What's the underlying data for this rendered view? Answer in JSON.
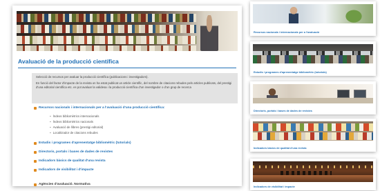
{
  "main": {
    "title": "Avaluació de la producció científica",
    "intro": [
      "Selecció de recursos per avaluar la producció científica (publicacions i investigadors).",
      "En funció del factor d'impacte de la revista on ha estat publicat un article científic, del nombre de citacions rebudes pels articles publicats, del prestigi d'una editorial científica etc. es pot avaluar la validesa i la producció científica d'un investigador o d'un grup de recerca"
    ],
    "sections": [
      {
        "label": "Recursos nacionals i internacionals per a l'avaluació d'una producció científica:",
        "subitems": [
          "Índexs bibliomètrics internacionals",
          "Índexs bibliomètrics nacionals",
          "Avaluació de llibres (prestigi editorial)",
          "Localitzador de citacions rebudes"
        ]
      },
      {
        "label": "Estudis i programes d'aprenentatge bibliomètric (tutorials)"
      },
      {
        "label": "Directoris, portals i bases de dades de revistes"
      },
      {
        "label": "Indicadors bàsics de qualitat d'una revista"
      },
      {
        "label": "Indicadors de visibilitat i d'impacte"
      },
      {
        "label": "Agències d'avaluació. Normativa"
      }
    ]
  },
  "thumbnails": [
    {
      "caption": "Recursos nacionals i internacionals per a l'avaluació"
    },
    {
      "caption": "Estudis i programes d'aprenentatge bibliomètric (tutorials)"
    },
    {
      "caption": "Directoris, portals i bases de dades de revistes"
    },
    {
      "caption": "Indicadors bàsics de qualitat d'una revista"
    },
    {
      "caption": "Indicadors de visibilitat i impacte"
    }
  ],
  "colors": {
    "link_blue": "#1f6fb5",
    "bullet_orange": "#e08a1e",
    "intro_bg": "#e3e3e3"
  }
}
